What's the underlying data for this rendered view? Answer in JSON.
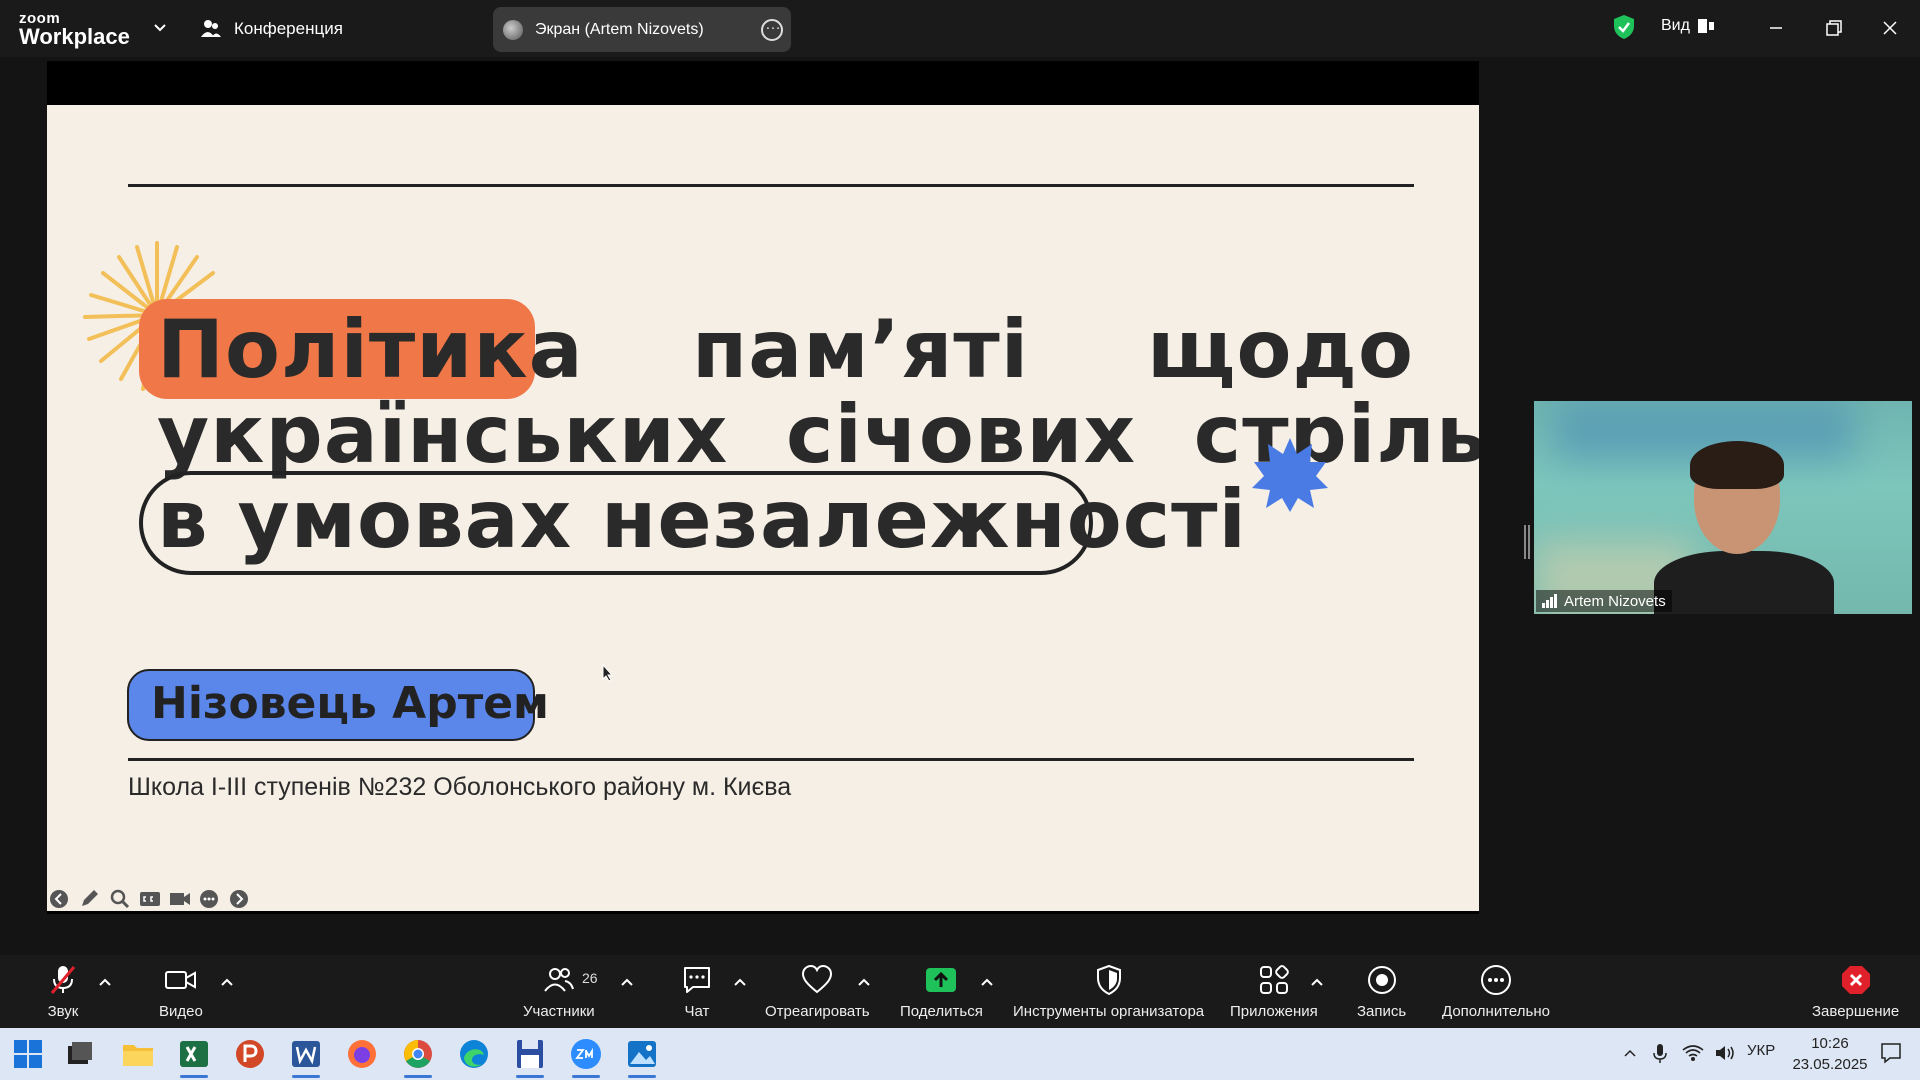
{
  "app": {
    "logo_small": "zoom",
    "logo_big": "Workplace",
    "meeting_label": "Конференция",
    "screen_share_label": "Экран (Artem Nizovets)",
    "view_label": "Вид"
  },
  "slide": {
    "title_word1": "Політика",
    "title_word2": "пам’яті",
    "title_word3": "щодо",
    "title_line2": "українських  січових  стрільців",
    "title_line3": "в умовах незалежності",
    "author": "Нізовець Артем",
    "school": "Школа І-ІІІ ступенів №232 Оболонського району м. Києва"
  },
  "participant": {
    "name": "Artem Nizovets"
  },
  "toolbar": {
    "audio": "Звук",
    "video": "Видео",
    "participants": "Участники",
    "participants_count": "26",
    "chat": "Чат",
    "react": "Отреагировать",
    "share": "Поделиться",
    "host_tools": "Инструменты организатора",
    "apps": "Приложения",
    "record": "Запись",
    "more": "Дополнительно",
    "end": "Завершение"
  },
  "taskbar": {
    "language": "УКР",
    "time": "10:26",
    "date": "23.05.2025"
  },
  "colors": {
    "slide_bg": "#f6efe6",
    "accent_orange": "#f07848",
    "accent_blue": "#5b86ea",
    "share_green": "#1fc15a",
    "end_red": "#e0202a"
  }
}
